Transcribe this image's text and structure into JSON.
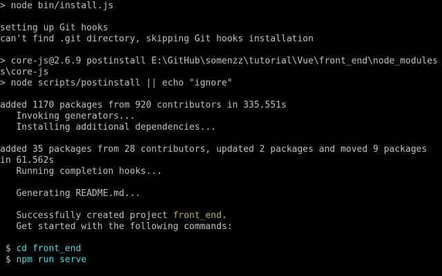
{
  "window": {
    "lines": [
      {
        "segments": [
          {
            "text": "> node bin/install.js",
            "color": "normal"
          }
        ]
      },
      {
        "segments": []
      },
      {
        "segments": [
          {
            "text": "setting up Git hooks",
            "color": "normal"
          }
        ]
      },
      {
        "segments": [
          {
            "text": "can't find .git directory, skipping Git hooks installation",
            "color": "normal"
          }
        ]
      },
      {
        "segments": []
      },
      {
        "segments": [
          {
            "text": "> core-js@2.6.9 postinstall E:\\GitHub\\somenzz\\tutorial\\Vue\\front_end\\node_modules",
            "color": "normal"
          }
        ]
      },
      {
        "segments": [
          {
            "text": "s\\core-js",
            "color": "normal"
          }
        ]
      },
      {
        "segments": [
          {
            "text": "> node scripts/postinstall || echo \"ignore\"",
            "color": "normal"
          }
        ]
      },
      {
        "segments": []
      },
      {
        "segments": [
          {
            "text": "added 1170 packages from 920 contributors in 335.551s",
            "color": "normal"
          }
        ]
      },
      {
        "segments": [
          {
            "text": "   Invoking generators...",
            "color": "normal"
          }
        ]
      },
      {
        "segments": [
          {
            "text": "   Installing additional dependencies...",
            "color": "normal"
          }
        ]
      },
      {
        "segments": []
      },
      {
        "segments": [
          {
            "text": "added 35 packages from 28 contributors, updated 2 packages and moved 9 packages",
            "color": "normal"
          }
        ]
      },
      {
        "segments": [
          {
            "text": "in 61.562s",
            "color": "normal"
          }
        ]
      },
      {
        "segments": [
          {
            "text": "   Running completion hooks...",
            "color": "normal"
          }
        ]
      },
      {
        "segments": []
      },
      {
        "segments": [
          {
            "text": "   Generating README.md...",
            "color": "normal"
          }
        ]
      },
      {
        "segments": []
      },
      {
        "segments": [
          {
            "text": "   Successfully created project ",
            "color": "normal"
          },
          {
            "text": "front_end",
            "color": "yellow"
          },
          {
            "text": ".",
            "color": "normal"
          }
        ]
      },
      {
        "segments": [
          {
            "text": "   Get started with the following commands:",
            "color": "normal"
          }
        ]
      },
      {
        "segments": []
      },
      {
        "segments": [
          {
            "text": " $ ",
            "color": "normal"
          },
          {
            "text": "cd front_end",
            "color": "cyan"
          }
        ]
      },
      {
        "segments": [
          {
            "text": " $ ",
            "color": "normal"
          },
          {
            "text": "npm run serve",
            "color": "cyan"
          }
        ]
      }
    ]
  },
  "colors": {
    "background": "#000000",
    "normal": "#c0c0c0",
    "yellow": "#b5b54a",
    "cyan": "#3fdede"
  }
}
